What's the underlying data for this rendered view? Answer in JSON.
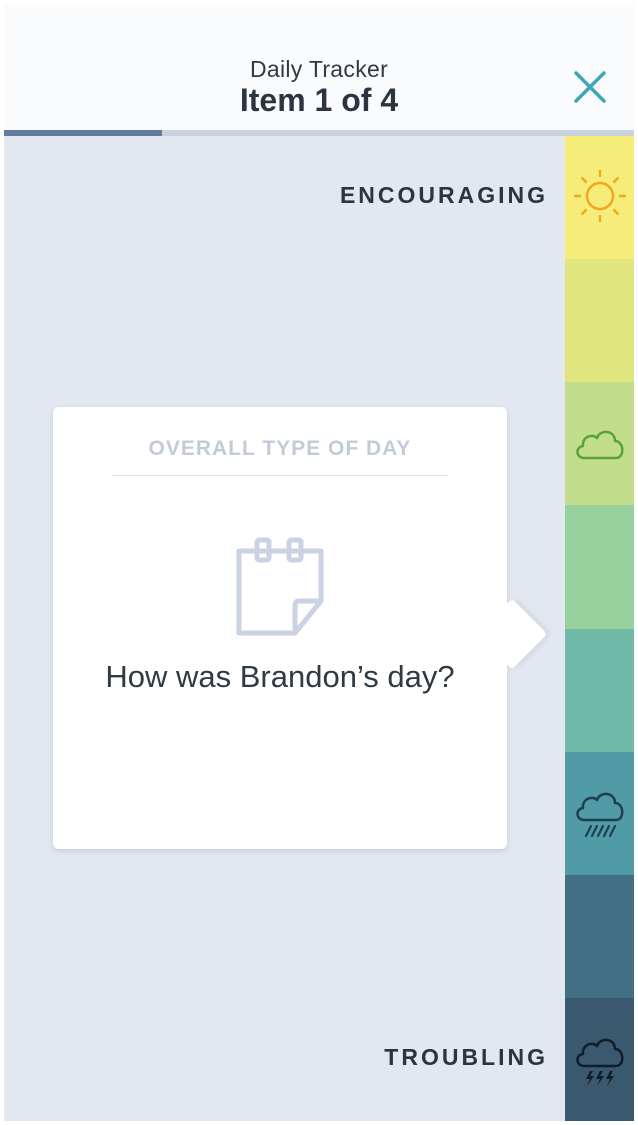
{
  "header": {
    "subtitle": "Daily Tracker",
    "title": "Item 1 of 4",
    "progress": {
      "current": 1,
      "total": 4
    }
  },
  "scale": {
    "top_label": "ENCOURAGING",
    "bottom_label": "TROUBLING",
    "segments": [
      {
        "color": "#f5ec79",
        "icon": "sun-icon",
        "icon_color": "#f0a81c"
      },
      {
        "color": "#e0e57f",
        "icon": "",
        "icon_color": ""
      },
      {
        "color": "#c2de8c",
        "icon": "cloud-icon",
        "icon_color": "#58a238"
      },
      {
        "color": "#97d19e",
        "icon": "",
        "icon_color": ""
      },
      {
        "color": "#70bba8",
        "icon": "",
        "icon_color": ""
      },
      {
        "color": "#509ba6",
        "icon": "rain-cloud-icon",
        "icon_color": "#1e3e52"
      },
      {
        "color": "#436f84",
        "icon": "",
        "icon_color": ""
      },
      {
        "color": "#3a596e",
        "icon": "storm-cloud-icon",
        "icon_color": "#0f1e2a"
      }
    ]
  },
  "card": {
    "heading": "OVERALL TYPE OF DAY",
    "icon": "calendar-note-icon",
    "question": "How was Brandon’s day?"
  },
  "colors": {
    "accent": "#3ba9b3",
    "progress_fill": "#617b9c",
    "background": "#e3e8f0"
  }
}
